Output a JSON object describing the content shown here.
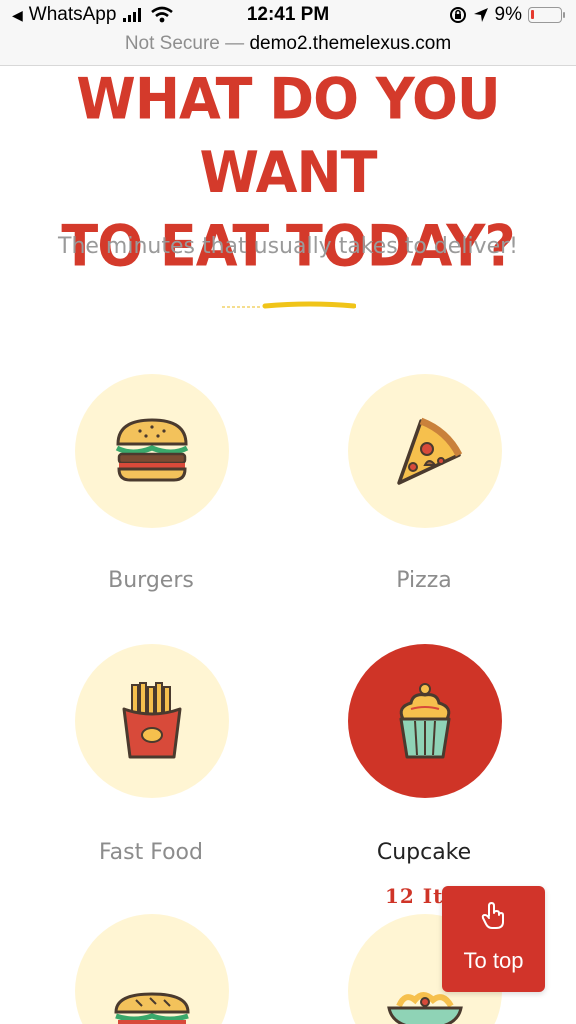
{
  "status_bar": {
    "back_app": "WhatsApp",
    "time": "12:41 PM",
    "battery": "9%",
    "icons": [
      "back-arrow-icon",
      "signal-icon",
      "wifi-icon",
      "orientation-lock-icon",
      "location-icon",
      "battery-icon"
    ]
  },
  "url_bar": {
    "security": "Not Secure",
    "separator": "—",
    "domain": "demo2.themelexus.com"
  },
  "section": {
    "heading_line1": "WHAT DO YOU WANT",
    "heading_line2": "TO EAT TODAY?",
    "subtitle": "The minutes that usually takes to deliver!"
  },
  "categories": [
    {
      "label": "Burgers",
      "icon": "burger-icon"
    },
    {
      "label": "Pizza",
      "icon": "pizza-icon"
    },
    {
      "label": "Fast Food",
      "icon": "fries-icon"
    },
    {
      "label": "Cupcake",
      "icon": "cupcake-icon",
      "active": true,
      "items": "12 Ite"
    },
    {
      "label": "",
      "icon": "sandwich-icon"
    },
    {
      "label": "",
      "icon": "noodles-bowl-icon"
    }
  ],
  "to_top": {
    "label": "To top",
    "icon": "pointer-hand-icon"
  },
  "colors": {
    "accent": "#d1342a",
    "circle_bg": "#fff5d3",
    "muted_text": "#9a9a9a"
  }
}
